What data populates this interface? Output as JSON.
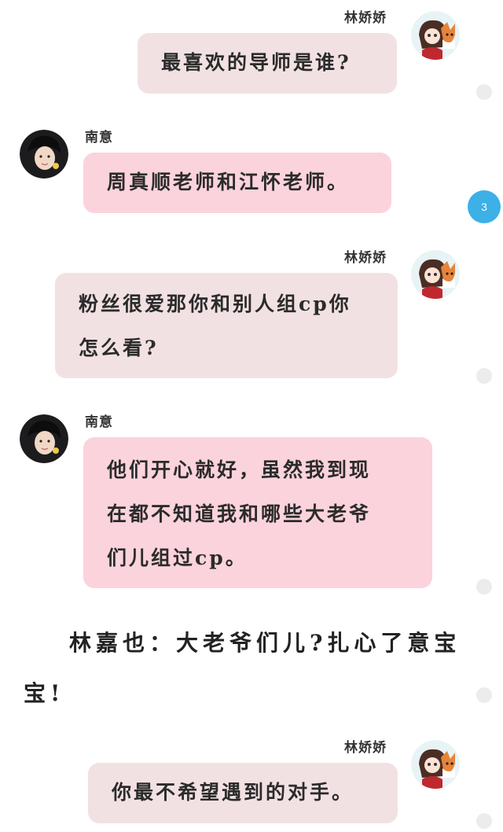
{
  "messages": [
    {
      "sender": "林娇娇",
      "side": "right",
      "text": "最喜欢的导师是谁?"
    },
    {
      "sender": "南意",
      "side": "left",
      "text": "周真顺老师和江怀老师。"
    },
    {
      "sender": "林娇娇",
      "side": "right",
      "text": "粉丝很爱那你和别人组cp你怎么看?"
    },
    {
      "sender": "南意",
      "side": "left",
      "text": "他们开心就好，虽然我到现在都不知道我和哪些大老爷们儿组过cp。"
    },
    {
      "sender": "林娇娇",
      "side": "right",
      "text": "你最不希望遇到的对手。"
    }
  ],
  "narration": "林嘉也：大老爷们儿?扎心了意宝宝!",
  "unread_badge": "3",
  "colors": {
    "mine_bubble": "#f2e1e3",
    "theirs_bubble": "#fbd3dc",
    "badge": "#3cb0e7",
    "status_dot": "#ececec"
  },
  "icons": {
    "linjiaojiao_avatar": "cartoon-girl-and-fox-avatar",
    "nanyi_avatar": "young-man-photo-avatar"
  }
}
